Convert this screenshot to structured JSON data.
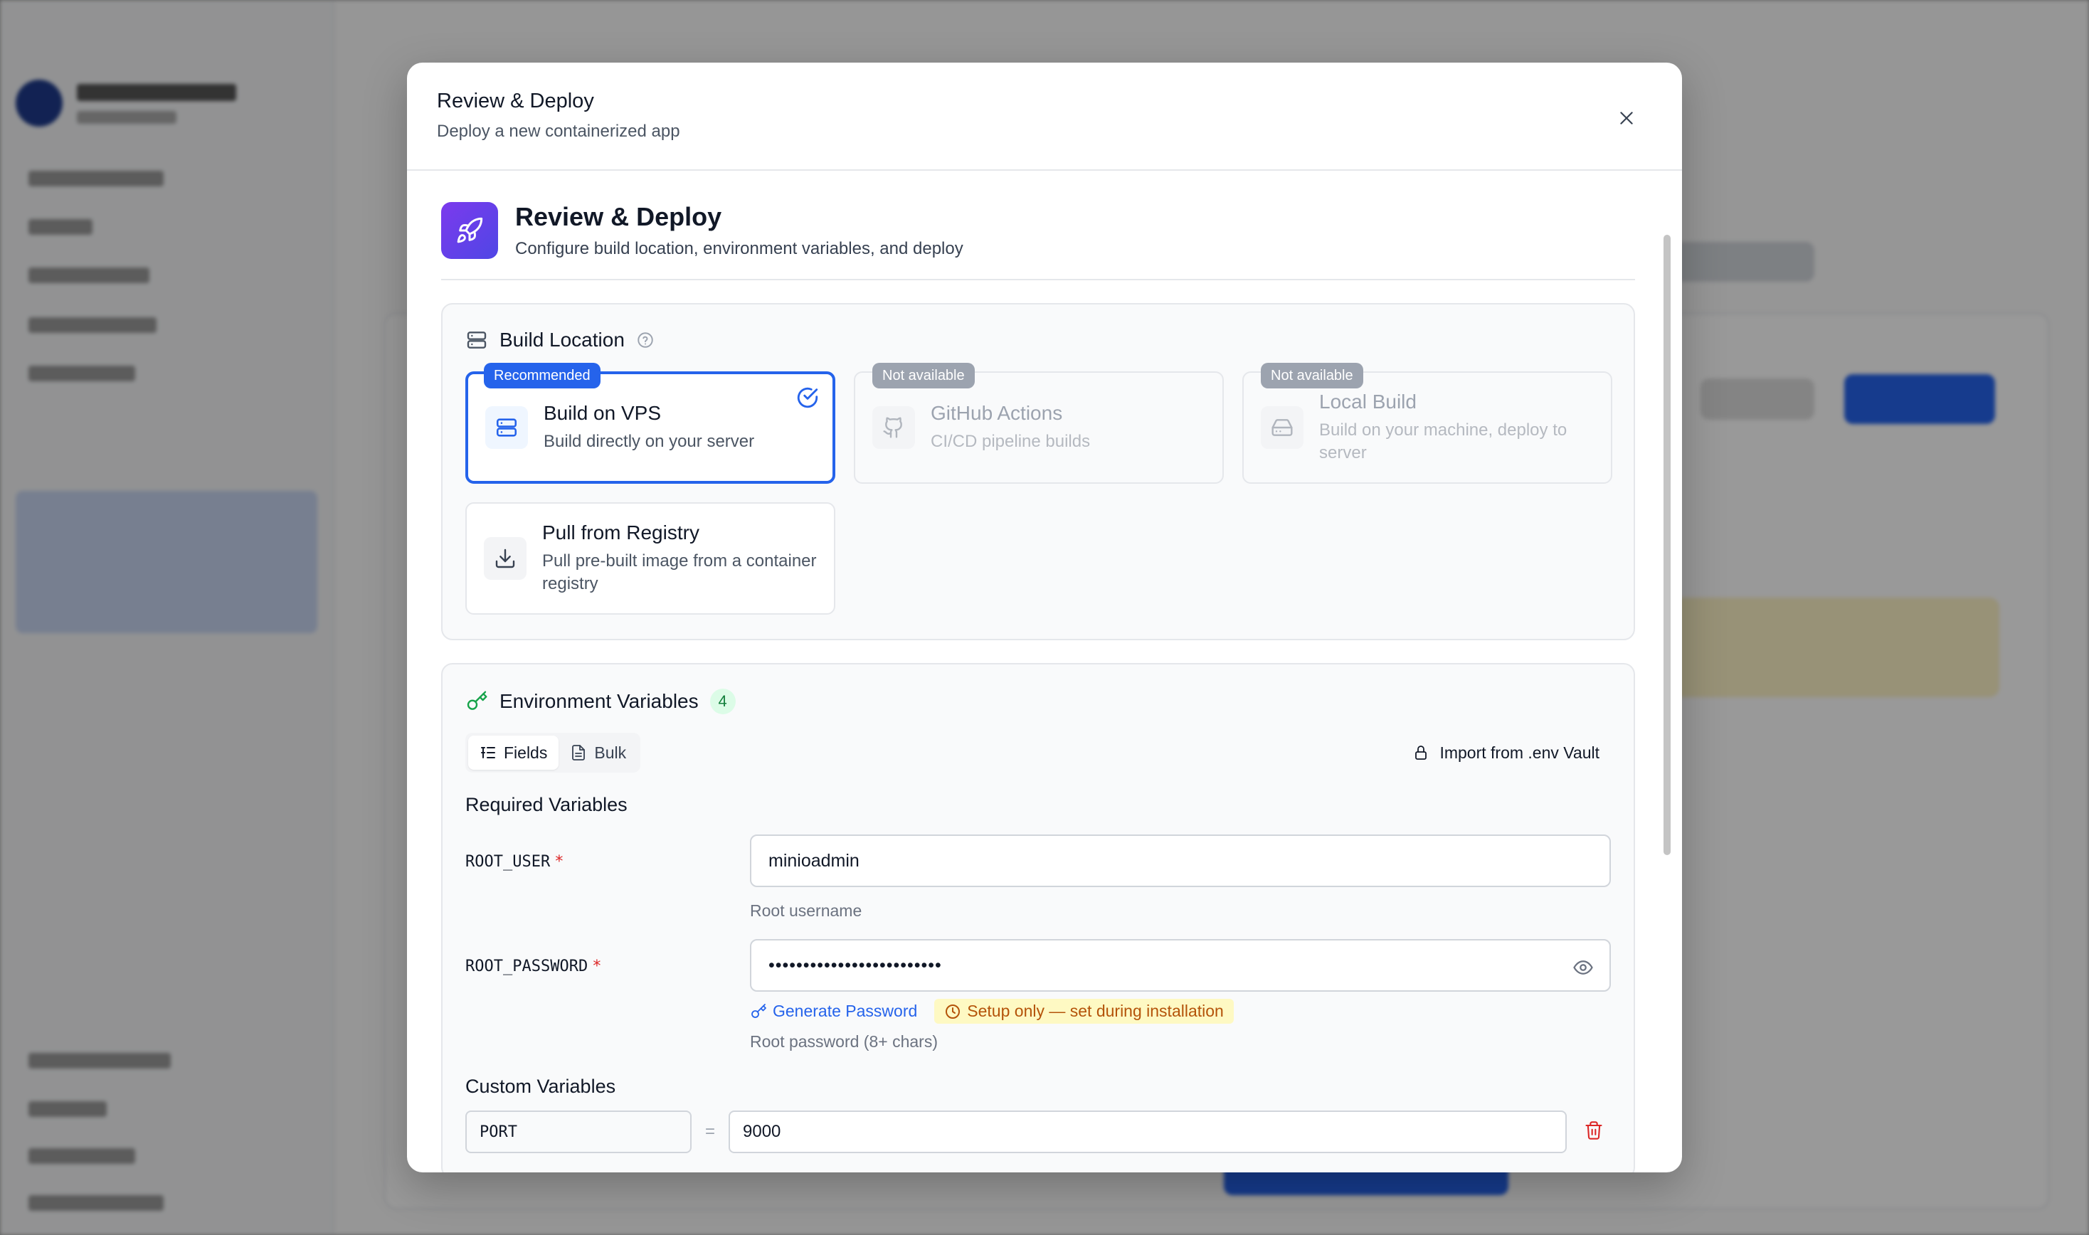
{
  "dialog": {
    "title": "Review & Deploy",
    "subtitle": "Deploy a new containerized app"
  },
  "step": {
    "title": "Review & Deploy",
    "subtitle": "Configure build location, environment variables, and deploy"
  },
  "build_location": {
    "title": "Build Location",
    "options": [
      {
        "name": "Build on VPS",
        "description": "Build directly on your server",
        "tag": "Recommended",
        "selected": true,
        "available": true
      },
      {
        "name": "GitHub Actions",
        "description": "CI/CD pipeline builds",
        "tag": "Not available",
        "selected": false,
        "available": false
      },
      {
        "name": "Local Build",
        "description": "Build on your machine, deploy to server",
        "tag": "Not available",
        "selected": false,
        "available": false
      },
      {
        "name": "Pull from Registry",
        "description": "Pull pre-built image from a container registry",
        "tag": "",
        "selected": false,
        "available": true
      }
    ]
  },
  "env": {
    "title": "Environment Variables",
    "count": "4",
    "tabs": {
      "fields": "Fields",
      "bulk": "Bulk"
    },
    "active_tab": "Fields",
    "import_label": "Import from .env Vault",
    "required_title": "Required Variables",
    "required": [
      {
        "key": "ROOT_USER",
        "value": "minioadmin",
        "hint": "Root username"
      },
      {
        "key": "ROOT_PASSWORD",
        "value": "•••••••••••••••••••••••••",
        "hint": "Root password (8+ chars)",
        "generate_label": "Generate Password",
        "setup_badge": "Setup only — set during installation"
      }
    ],
    "custom_title": "Custom Variables",
    "custom": [
      {
        "key": "PORT",
        "value": "9000"
      }
    ]
  },
  "colors": {
    "accent": "#2563eb",
    "badge_green": "#15803d",
    "required_star": "#dc2626",
    "warning": "#b45309",
    "delete": "#dc2626"
  }
}
